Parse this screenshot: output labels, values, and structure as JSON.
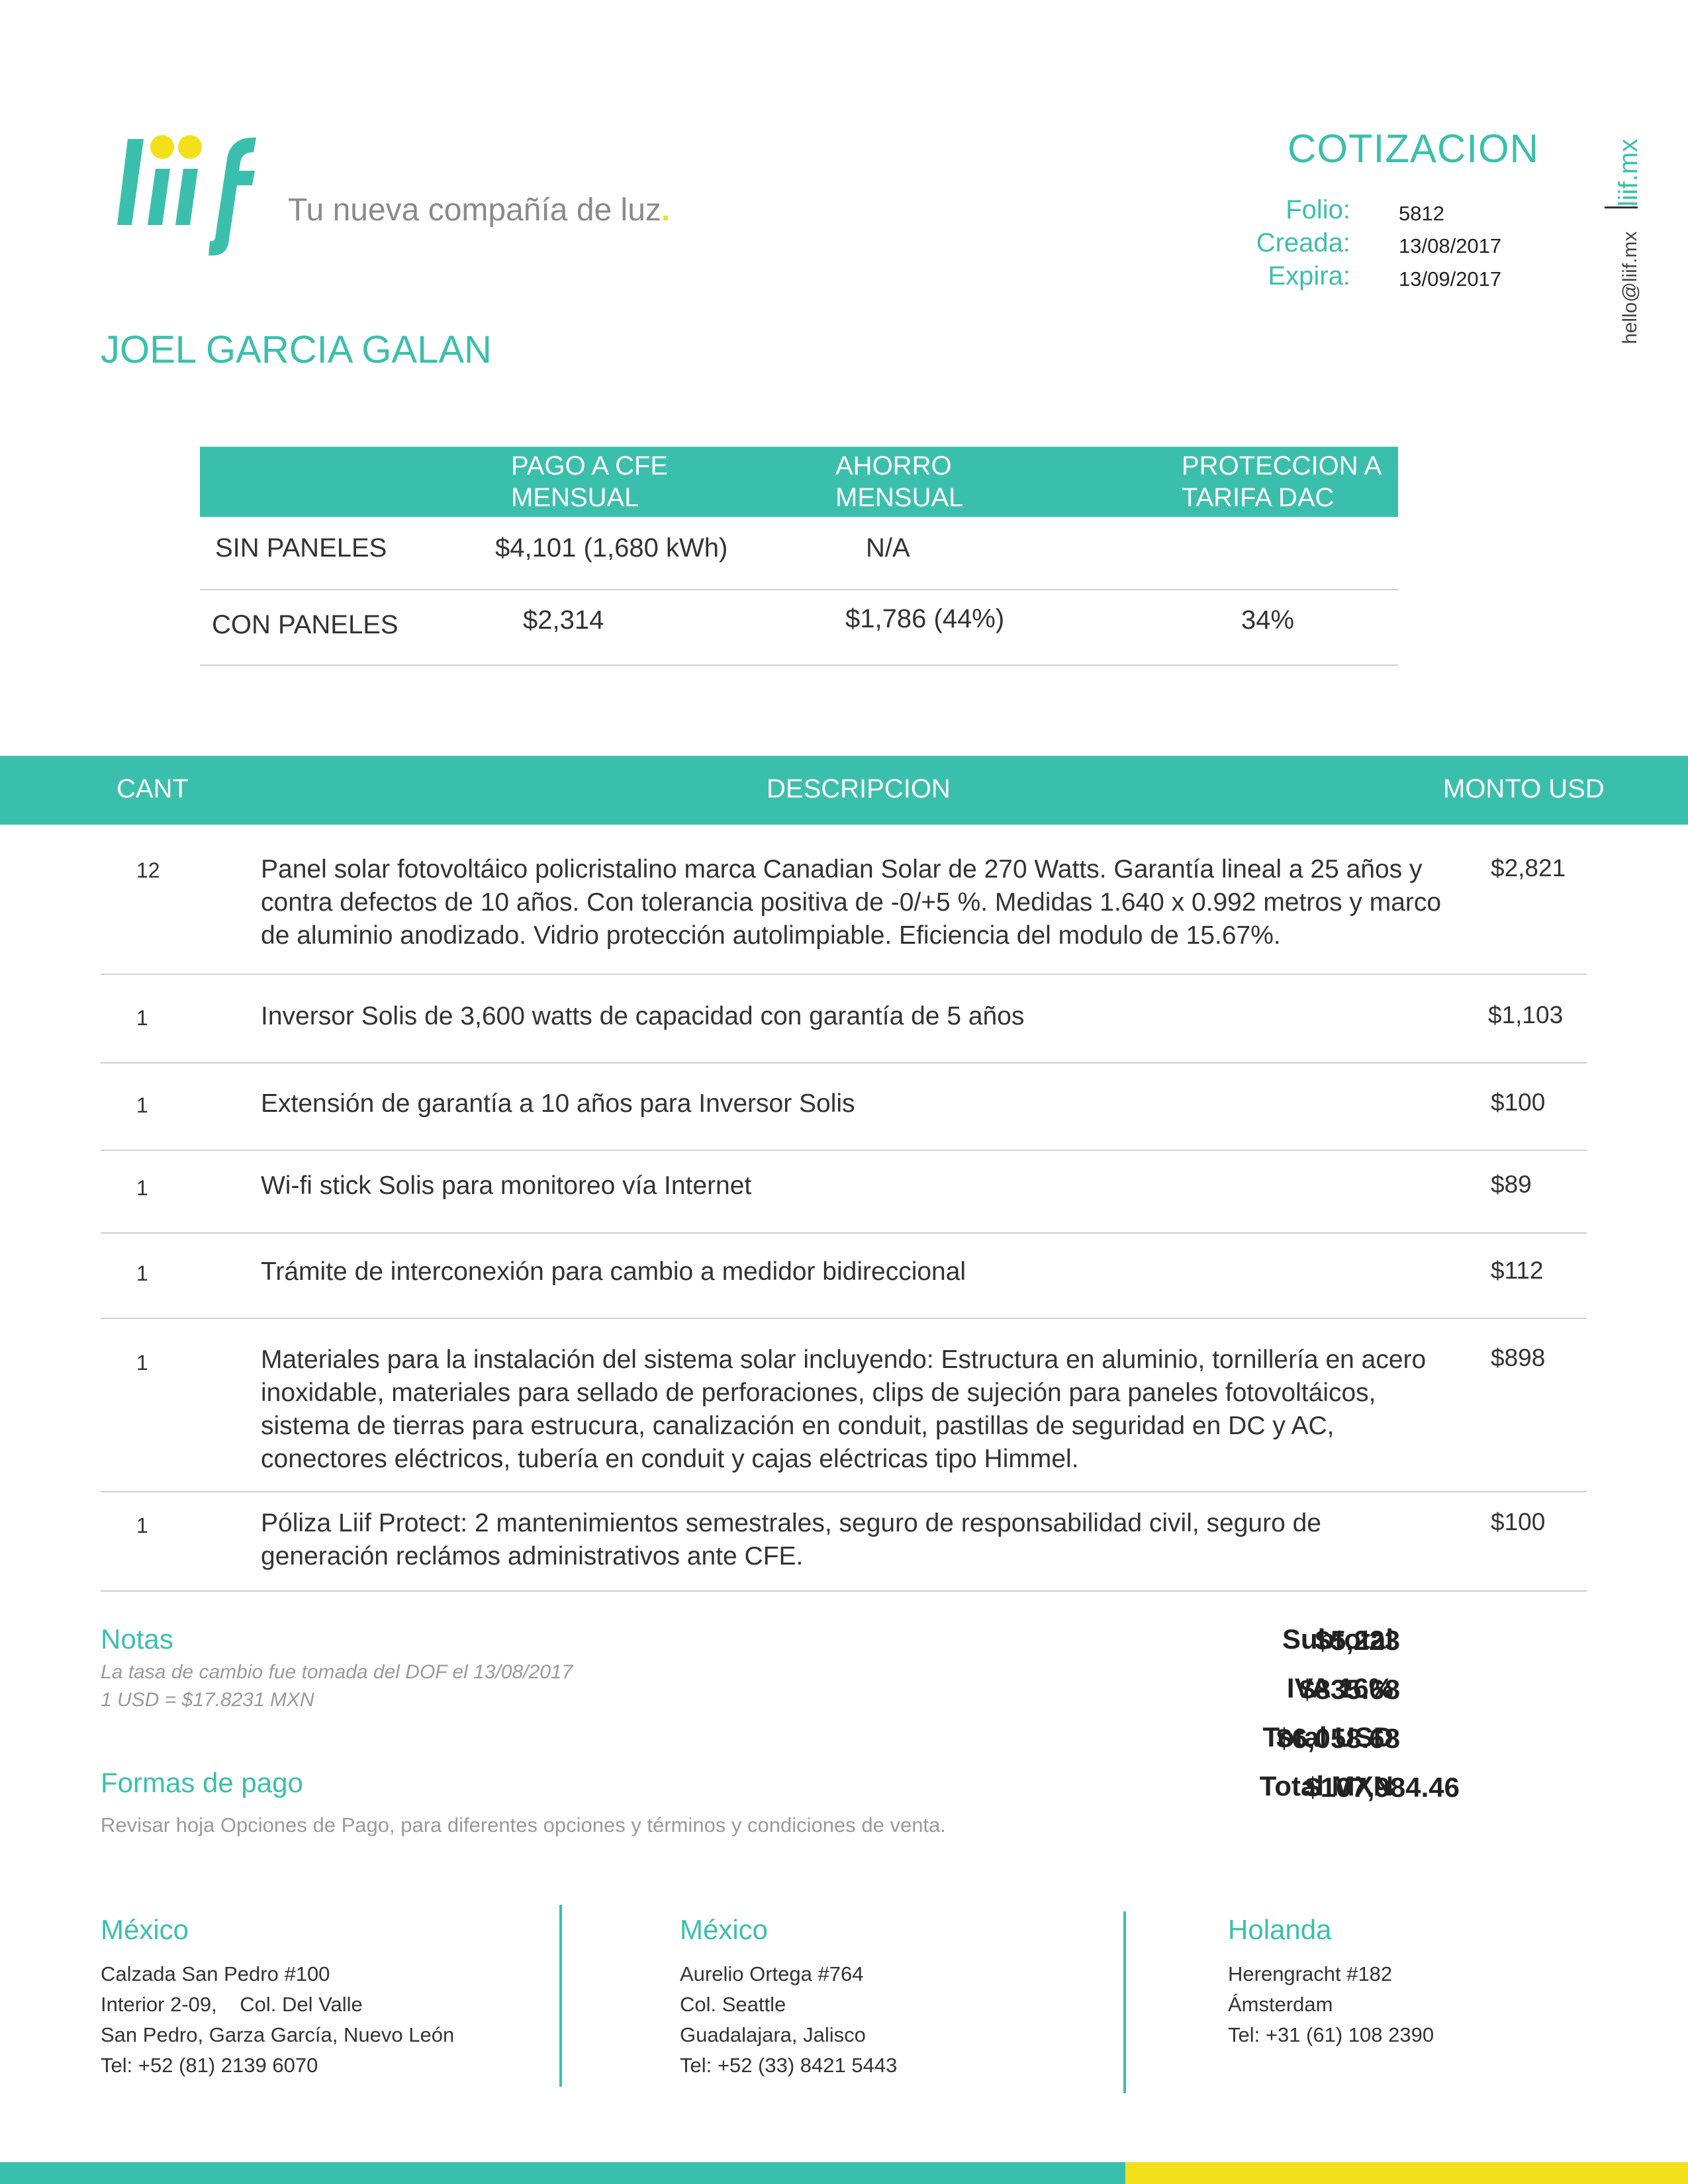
{
  "brand": {
    "tagline": "Tu nueva compañía de luz",
    "tagline_dot": ".",
    "colors": {
      "primary": "#3bbfad",
      "accent": "#f4e01a"
    },
    "side_url": "liif.mx",
    "side_email": "hello@liif.mx"
  },
  "header": {
    "title": "COTIZACION",
    "folio_label": "Folio:",
    "folio": "5812",
    "created_label": "Creada:",
    "created": "13/08/2017",
    "expires_label": "Expira:",
    "expires": "13/09/2017"
  },
  "client_name": "JOEL GARCIA GALAN",
  "comparison": {
    "headers": [
      "PAGO A CFE\nMENSUAL",
      "AHORRO\nMENSUAL",
      "PROTECCION  A\nTARIFA DAC"
    ],
    "rows": [
      {
        "label": "SIN PANELES",
        "pago": "$4,101 (1,680 kWh)",
        "ahorro": "N/A",
        "proteccion": ""
      },
      {
        "label": "CON PANELES",
        "pago": "$2,314",
        "ahorro": "$1,786 (44%)",
        "proteccion": "34%"
      }
    ]
  },
  "items": {
    "headers": {
      "qty": "CANT",
      "desc": "DESCRIPCION",
      "amount": "MONTO USD"
    },
    "rows": [
      {
        "qty": "12",
        "desc": "Panel solar fotovoltáico policristalino marca Canadian Solar de 270 Watts. Garantía lineal a 25 años y contra defectos de 10 años. Con tolerancia positiva de -0/+5 %. Medidas 1.640 x 0.992 metros y marco de aluminio anodizado. Vidrio protección autolimpiable. Eficiencia del modulo de 15.67%.",
        "amount": "$2,821"
      },
      {
        "qty": "1",
        "desc": "Inversor Solis de 3,600 watts de capacidad con garantía de 5 años",
        "amount": "$1,103"
      },
      {
        "qty": "1",
        "desc": "Extensión de garantía a 10 años para Inversor Solis",
        "amount": "$100"
      },
      {
        "qty": "1",
        "desc": "Wi-fi stick Solis para monitoreo vía Internet",
        "amount": "$89"
      },
      {
        "qty": "1",
        "desc": "Trámite de interconexión para cambio a medidor bidireccional",
        "amount": "$112"
      },
      {
        "qty": "1",
        "desc": "Materiales para la instalación del sistema solar incluyendo: Estructura en aluminio, tornillería en acero inoxidable, materiales para sellado de perforaciones, clips de sujeción para paneles fotovoltáicos, sistema de tierras para estrucura, canalización en conduit, pastillas de seguridad en DC y AC, conectores eléctricos, tubería en conduit y cajas eléctricas tipo Himmel.",
        "amount": "$898"
      },
      {
        "qty": "1",
        "desc": "Póliza Liif Protect: 2 mantenimientos semestrales, seguro de responsabilidad civil, seguro de generación reclámos administrativos ante CFE.",
        "amount": "$100"
      }
    ]
  },
  "notes": {
    "title": "Notas",
    "line1": "La tasa de cambio fue tomada del DOF el 13/08/2017",
    "line2": "1 USD = $17.8231 MXN"
  },
  "payment": {
    "title": "Formas de pago",
    "text": "Revisar hoja Opciones de Pago, para diferentes opciones y términos y condiciones de venta."
  },
  "totals": {
    "subtotal_label": "Subtotal",
    "subtotal": "$5,223",
    "iva_label": "IVA 16%",
    "iva": "$835.68",
    "usd_label": "Total USD",
    "usd": "$6,058.68",
    "mxn_label": "Total MXN",
    "mxn": "$107,984.46"
  },
  "offices": [
    {
      "country": "México",
      "lines": [
        "Calzada San Pedro #100",
        "Interior 2-09,    Col. Del Valle",
        "San Pedro, Garza García, Nuevo León",
        "Tel: +52 (81) 2139 6070"
      ]
    },
    {
      "country": "México",
      "lines": [
        "Aurelio Ortega #764",
        "Col. Seattle",
        "Guadalajara, Jalisco",
        "Tel: +52 (33) 8421 5443"
      ]
    },
    {
      "country": "Holanda",
      "lines": [
        "Herengracht #182",
        "Ámsterdam",
        "Tel: +31 (61) 108 2390"
      ]
    }
  ]
}
